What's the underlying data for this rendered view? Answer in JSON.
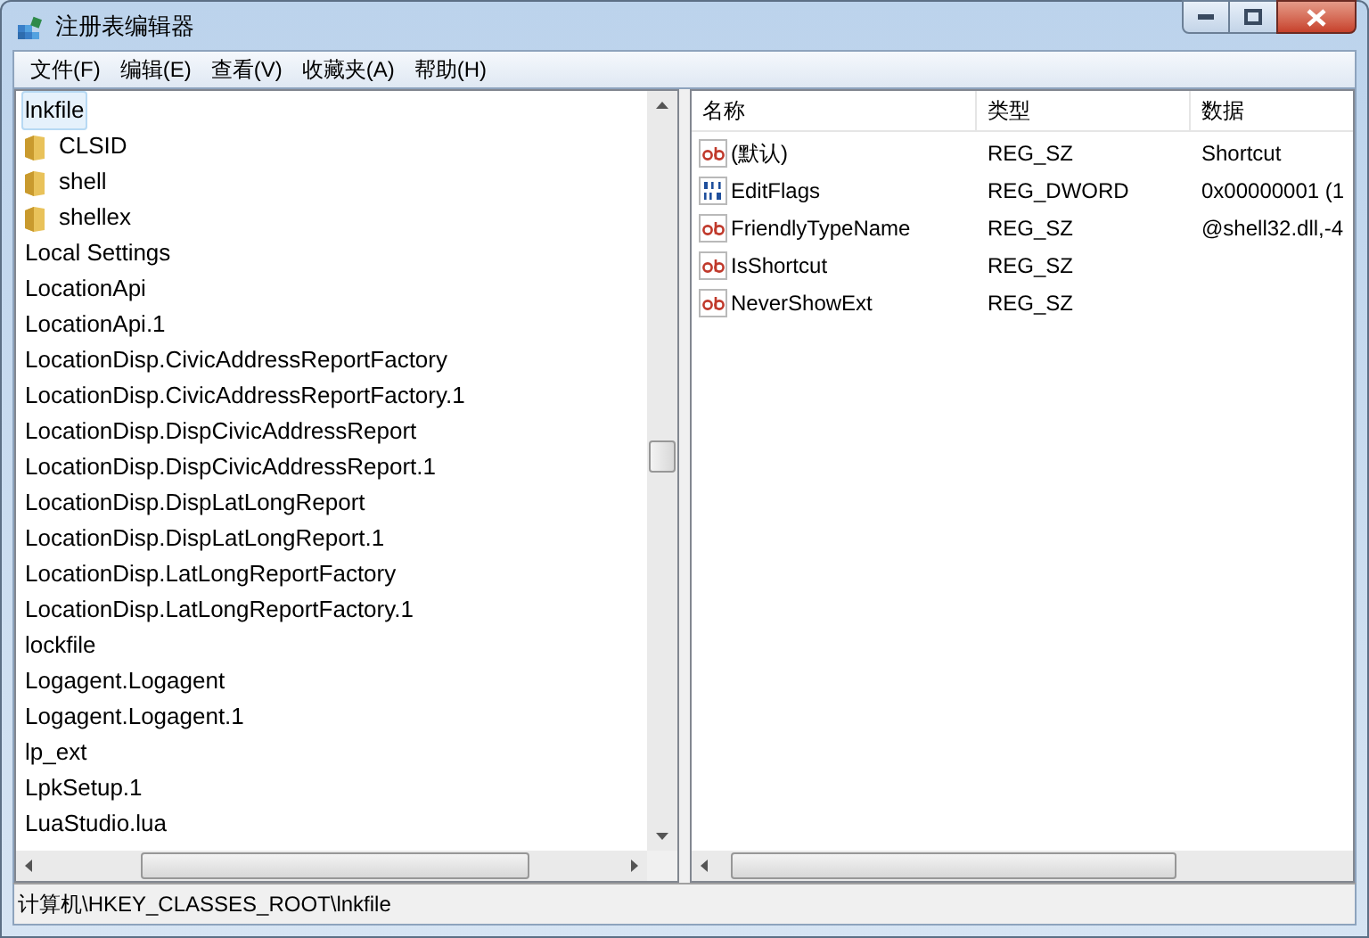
{
  "window": {
    "title": "注册表编辑器"
  },
  "menu": [
    "文件(F)",
    "编辑(E)",
    "查看(V)",
    "收藏夹(A)",
    "帮助(H)"
  ],
  "tree": [
    {
      "label": "lnkfile",
      "selected": true,
      "children": [
        {
          "label": "CLSID",
          "selected": false
        },
        {
          "label": "shell",
          "selected": false
        },
        {
          "label": "shellex",
          "selected": false
        }
      ]
    },
    {
      "label": "Local Settings",
      "selected": false
    },
    {
      "label": "LocationApi",
      "selected": false
    },
    {
      "label": "LocationApi.1",
      "selected": false
    },
    {
      "label": "LocationDisp.CivicAddressReportFactory",
      "selected": false
    },
    {
      "label": "LocationDisp.CivicAddressReportFactory.1",
      "selected": false
    },
    {
      "label": "LocationDisp.DispCivicAddressReport",
      "selected": false
    },
    {
      "label": "LocationDisp.DispCivicAddressReport.1",
      "selected": false
    },
    {
      "label": "LocationDisp.DispLatLongReport",
      "selected": false
    },
    {
      "label": "LocationDisp.DispLatLongReport.1",
      "selected": false
    },
    {
      "label": "LocationDisp.LatLongReportFactory",
      "selected": false
    },
    {
      "label": "LocationDisp.LatLongReportFactory.1",
      "selected": false
    },
    {
      "label": "lockfile",
      "selected": false
    },
    {
      "label": "Logagent.Logagent",
      "selected": false
    },
    {
      "label": "Logagent.Logagent.1",
      "selected": false
    },
    {
      "label": "lp_ext",
      "selected": false
    },
    {
      "label": "LpkSetup.1",
      "selected": false
    },
    {
      "label": "LuaStudio.lua",
      "selected": false
    }
  ],
  "table": {
    "columns": [
      "名称",
      "类型",
      "数据"
    ],
    "rows": [
      {
        "kind": "string",
        "name": "(默认)",
        "type": "REG_SZ",
        "data": "Shortcut"
      },
      {
        "kind": "binary",
        "name": "EditFlags",
        "type": "REG_DWORD",
        "data": "0x00000001 (1"
      },
      {
        "kind": "string",
        "name": "FriendlyTypeName",
        "type": "REG_SZ",
        "data": "@shell32.dll,-4"
      },
      {
        "kind": "string",
        "name": "IsShortcut",
        "type": "REG_SZ"
      },
      {
        "kind": "string",
        "name": "NeverShowExt",
        "type": "REG_SZ"
      }
    ]
  },
  "status_bar": "计算机\\HKEY_CLASSES_ROOT\\lnkfile"
}
